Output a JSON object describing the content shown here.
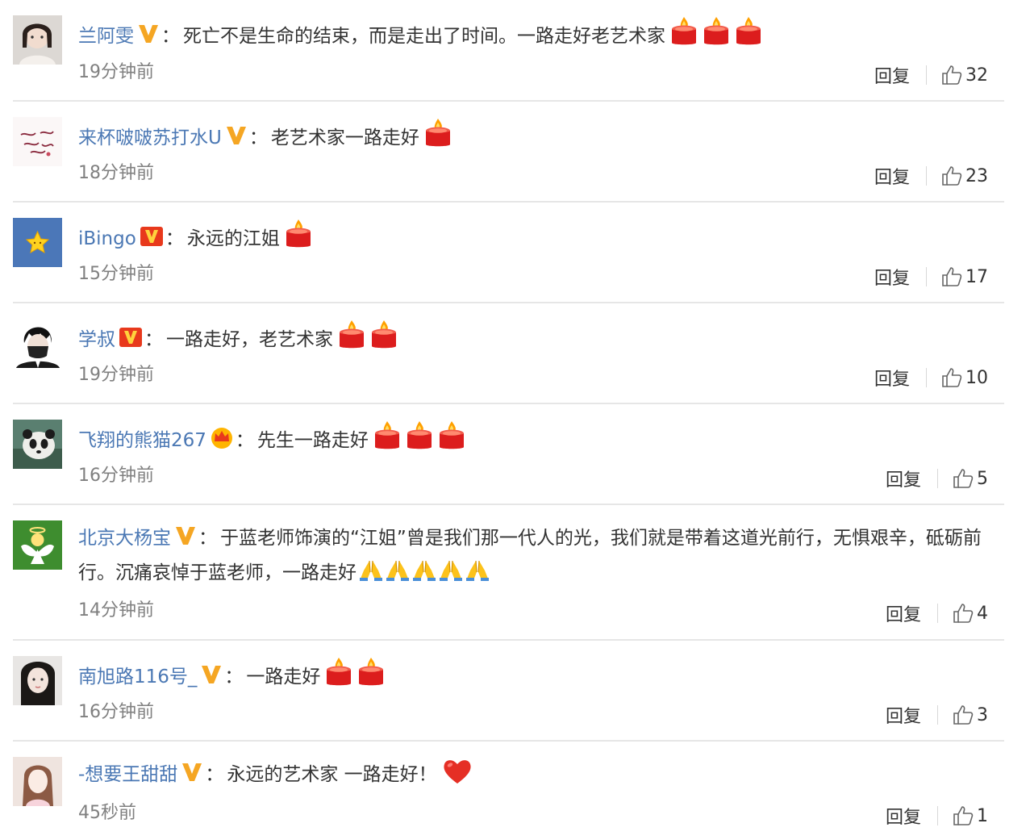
{
  "comments": [
    {
      "username": "兰阿雯",
      "badge": "v-yellow",
      "text": "死亡不是生命的结束，而是走出了时间。一路走好老艺术家",
      "emojis": [
        "candle",
        "candle",
        "candle"
      ],
      "time": "19分钟前",
      "reply_label": "回复",
      "likes": "32",
      "avatar": "girl-portrait"
    },
    {
      "username": "来杯啵啵苏打水U",
      "badge": "v-yellow",
      "text": "老艺术家一路走好",
      "emojis": [
        "candle"
      ],
      "time": "18分钟前",
      "reply_label": "回复",
      "likes": "23",
      "avatar": "calligraphy"
    },
    {
      "username": "iBingo",
      "badge": "v-red",
      "text": "永远的江姐",
      "emojis": [
        "candle"
      ],
      "time": "15分钟前",
      "reply_label": "回复",
      "likes": "17",
      "avatar": "star-blue"
    },
    {
      "username": "学叔",
      "badge": "v-red",
      "text": "一路走好，老艺术家",
      "emojis": [
        "candle",
        "candle"
      ],
      "time": "19分钟前",
      "reply_label": "回复",
      "likes": "10",
      "avatar": "masked-man"
    },
    {
      "username": "飞翔的熊猫267",
      "badge": "crown",
      "text": "先生一路走好",
      "emojis": [
        "candle",
        "candle",
        "candle"
      ],
      "time": "16分钟前",
      "reply_label": "回复",
      "likes": "5",
      "avatar": "panda"
    },
    {
      "username": "北京大杨宝",
      "badge": "v-yellow",
      "text": "于蓝老师饰演的“江姐”曾是我们那一代人的光，我们就是带着这道光前行，无惧艰辛，砥砺前行。沉痛哀悼于蓝老师，一路走好",
      "emojis": [
        "pray",
        "pray",
        "pray",
        "pray",
        "pray"
      ],
      "time": "14分钟前",
      "reply_label": "回复",
      "likes": "4",
      "avatar": "angel-green"
    },
    {
      "username": "南旭路116号_",
      "badge": "v-yellow",
      "text": "一路走好",
      "emojis": [
        "candle",
        "candle"
      ],
      "time": "16分钟前",
      "reply_label": "回复",
      "likes": "3",
      "avatar": "girl-dark"
    },
    {
      "username": "-想要王甜甜",
      "badge": "v-yellow",
      "text": "永远的艺术家 一路走好！",
      "emojis": [
        "heart"
      ],
      "time": "45秒前",
      "reply_label": "回复",
      "likes": "1",
      "avatar": "girl-light"
    }
  ],
  "colors": {
    "username": "#4b78b4",
    "time": "#808080",
    "divider": "#e6e6e6",
    "badge_yellow": "#f5a623",
    "badge_red": "#e8391c"
  }
}
